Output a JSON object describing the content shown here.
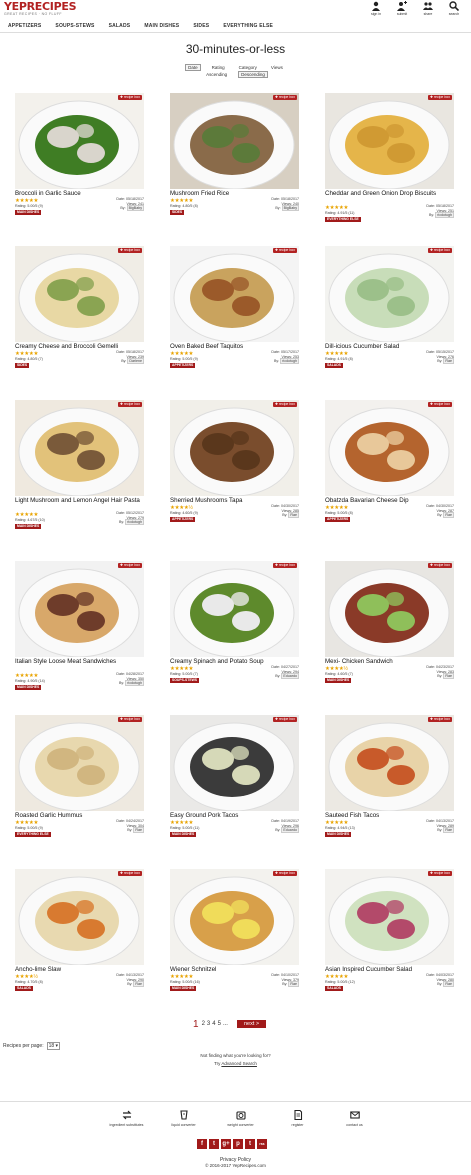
{
  "header": {
    "logo_text": "YEPRECIPES",
    "logo_tagline": "GREAT RECIPES · NO FLUFF",
    "icons": [
      {
        "name": "sign-in-icon",
        "label": "sign in"
      },
      {
        "name": "submit-icon",
        "label": "submit"
      },
      {
        "name": "share-icon",
        "label": "share"
      },
      {
        "name": "search-icon",
        "label": "search"
      }
    ]
  },
  "nav": [
    "APPETIZERS",
    "SOUPS-STEWS",
    "SALADS",
    "MAIN DISHES",
    "SIDES",
    "EVERYTHING ELSE"
  ],
  "page_title": "30-minutes-or-less",
  "sort": {
    "options": [
      "Date",
      "Rating",
      "Category",
      "Views"
    ],
    "order": [
      "Ascending",
      "Descending"
    ],
    "active_option": "Date",
    "active_order": "Descending"
  },
  "recipe_box_label": "recipe box",
  "recipes": [
    {
      "title": "Broccoli in Garlic Sauce",
      "date": "Date: 05/18/2017",
      "views": "Views: 241",
      "rating": "Rating: 5.00/5  (9)",
      "by": "BigBaby",
      "category": "MAIN DISHES",
      "stars": "★★★★★"
    },
    {
      "title": "Mushroom Fried Rice",
      "date": "Date: 05/18/2017",
      "views": "Views: 240",
      "rating": "Rating: 4.80/5  (8)",
      "by": "BigBaby",
      "category": "SIDES",
      "stars": "★★★★★"
    },
    {
      "title": "Cheddar and Green Onion Drop Biscuits",
      "date": "Date: 05/18/2017",
      "views": "Views: 251",
      "rating": "Rating: 4.91/5  (11)",
      "by": "ricdotugh",
      "category": "EVERYTHING ELSE",
      "stars": "★★★★★"
    },
    {
      "title": "Creamy Cheese and Broccoli Gemelli",
      "date": "Date: 05/18/2017",
      "views": "Views: 239",
      "rating": "Rating: 4.80/5  (7)",
      "by": "Darlene",
      "category": "SIDES",
      "stars": "★★★★★"
    },
    {
      "title": "Oven Baked Beef Taquitos",
      "date": "Date: 05/17/2017",
      "views": "Views: 253",
      "rating": "Rating: 5.00/5  (9)",
      "by": "ricdotugh",
      "category": "APPETIZERS",
      "stars": "★★★★★"
    },
    {
      "title": "Dill-icious Cucumber Salad",
      "date": "Date: 05/15/2017",
      "views": "Views: 276",
      "rating": "Rating: 4.91/5  (8)",
      "by": "Rae",
      "category": "SALADS",
      "stars": "★★★★★"
    },
    {
      "title": "Light Mushroom and Lemon Angel Hair Pasta",
      "date": "Date: 05/12/2017",
      "views": "Views: 279",
      "rating": "Rating: 4.67/5  (10)",
      "by": "ricdotugh",
      "category": "MAIN DISHES",
      "stars": "★★★★★"
    },
    {
      "title": "Sherried Mushrooms Tapa",
      "date": "Date: 04/30/2017",
      "views": "Views: 285",
      "rating": "Rating: 4.60/5  (9)",
      "by": "Rae",
      "category": "APPETIZERS",
      "stars": "★★★★½"
    },
    {
      "title": "Obatzda Bavarian Cheese Dip",
      "date": "Date: 04/30/2017",
      "views": "Views: 287",
      "rating": "Rating: 5.00/5  (8)",
      "by": "Rae",
      "category": "APPETIZERS",
      "stars": "★★★★★"
    },
    {
      "title": "Italian Style Loose Meat Sandwiches",
      "date": "Date: 04/28/2017",
      "views": "Views: 350",
      "rating": "Rating: 4.90/5  (14)",
      "by": "ricdotugh",
      "category": "MAIN DISHES",
      "stars": "★★★★★"
    },
    {
      "title": "Creamy Spinach and Potato Soup",
      "date": "Date: 04/27/2017",
      "views": "Views: 294",
      "rating": "Rating: 5.00/5  (7)",
      "by": "Eduardo",
      "category": "SOUPS-STEWS",
      "stars": "★★★★★"
    },
    {
      "title": "Mexi- Chicken Sandwich",
      "date": "Date: 04/23/2017",
      "views": "Views: 283",
      "rating": "Rating: 4.60/5  (7)",
      "by": "Rae",
      "category": "MAIN DISHES",
      "stars": "★★★★½"
    },
    {
      "title": "Roasted Garlic Hummus",
      "date": "Date: 04/24/2017",
      "views": "Views: 304",
      "rating": "Rating: 5.00/5  (9)",
      "by": "Rae",
      "category": "EVERYTHING ELSE",
      "stars": "★★★★★"
    },
    {
      "title": "Easy Ground Pork Tacos",
      "date": "Date: 04/19/2017",
      "views": "Views: 296",
      "rating": "Rating: 5.00/5  (11)",
      "by": "Eduardo",
      "category": "MAIN DISHES",
      "stars": "★★★★★"
    },
    {
      "title": "Sauteed Fish Tacos",
      "date": "Date: 04/13/2017",
      "views": "Views: 289",
      "rating": "Rating: 4.94/5  (13)",
      "by": "Rae",
      "category": "MAIN DISHES",
      "stars": "★★★★★"
    },
    {
      "title": "Ancho-lime Slaw",
      "date": "Date: 04/13/2017",
      "views": "Views: 290",
      "rating": "Rating: 4.70/5  (8)",
      "by": "Rae",
      "category": "SALADS",
      "stars": "★★★★½"
    },
    {
      "title": "Wiener Schnitzel",
      "date": "Date: 04/10/2017",
      "views": "Views: 379",
      "rating": "Rating: 5.00/5  (16)",
      "by": "Rae",
      "category": "MAIN DISHES",
      "stars": "★★★★★"
    },
    {
      "title": "Asian Inspired Cucumber Salad",
      "date": "Date: 04/03/2017",
      "views": "Views: 280",
      "rating": "Rating: 5.00/5  (12)",
      "by": "Rae",
      "category": "SALADS",
      "stars": "★★★★★"
    }
  ],
  "by_label": "By:",
  "pagination": {
    "current": "1",
    "pages": [
      "2",
      "3",
      "4",
      "5"
    ],
    "ellipsis": "...",
    "next": "next >"
  },
  "per_page": {
    "label": "Recipes per page:",
    "value": "18"
  },
  "not_finding": "Not finding what you're looking for?",
  "advanced_search": {
    "prefix": "Try ",
    "link": "Advanced Search"
  },
  "footer": {
    "links": [
      "ingredient substitutes",
      "liquid converter",
      "weight converter",
      "register",
      "contact us"
    ],
    "social": [
      "f",
      "t",
      "g+",
      "p",
      "t",
      "rss"
    ],
    "privacy": "Privacy Policy",
    "copyright": "© 2016-2017 YepRecipes.com"
  },
  "colors": {
    "brand": "#a11a1a",
    "star": "#e8a300"
  }
}
